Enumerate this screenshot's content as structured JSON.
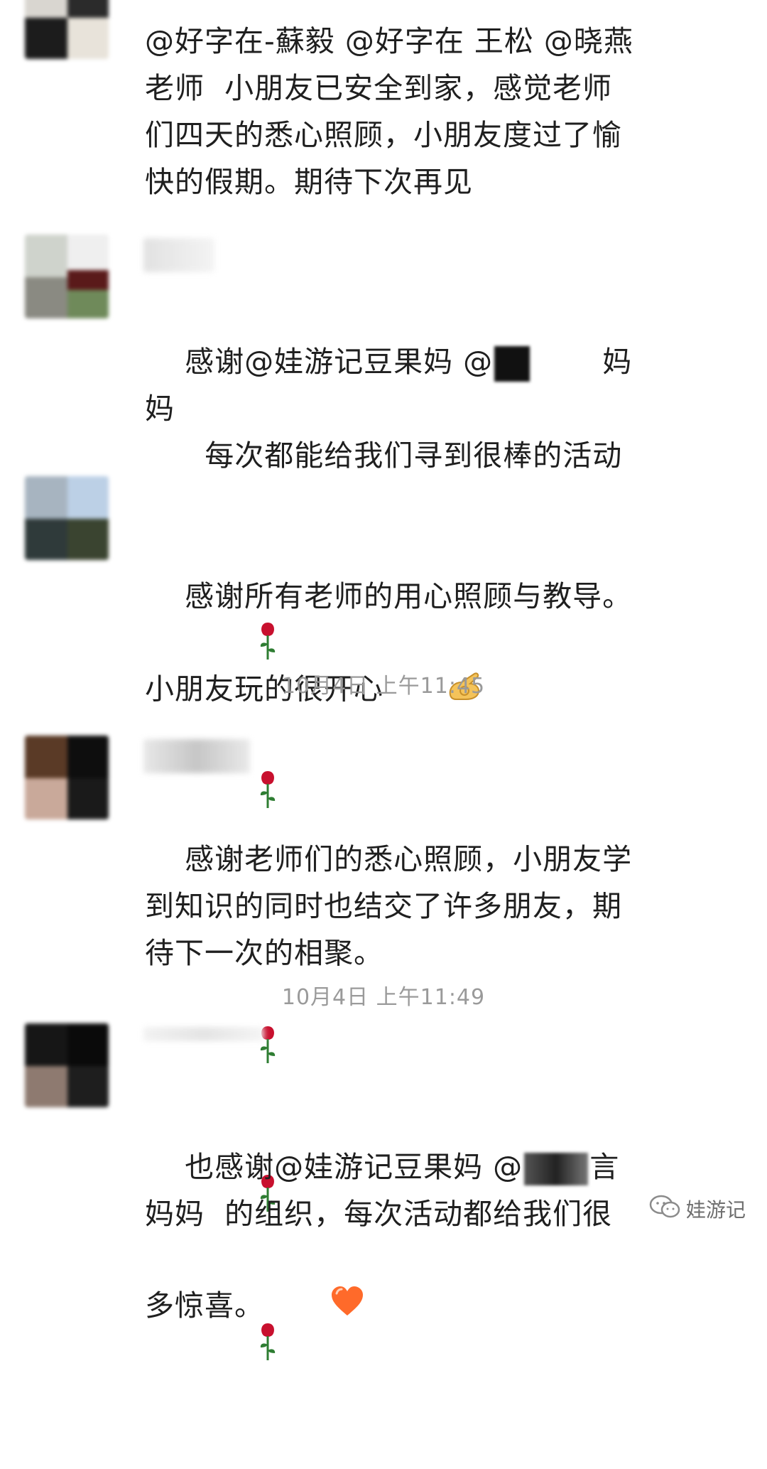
{
  "messages": [
    {
      "text": "@好字在-蘇毅 @好字在 王松 @晓燕老师  小朋友已安全到家，感觉老师们四天的悉心照顾，小朋友度过了愉快的假期。期待下次再见"
    },
    {
      "text_a": "感谢@娃游记豆果妈 @",
      "text_b": "妈妈",
      "text_c": "  每次都能给我们寻到很棒的活动",
      "emoji": "rose-icon"
    },
    {
      "text": "感谢所有老师的用心照顾与教导。小朋友玩的很开心",
      "emoji": "ok-hand-icon"
    },
    {
      "text": "感谢老师们的悉心照顾，小朋友学到知识的同时也结交了许多朋友，期待下一次的相聚。",
      "emoji": "rose-icon"
    },
    {
      "text_a": "也感谢@娃游记豆果妈 @",
      "text_b": "言妈妈",
      "text_c": "  的组织，每次活动都给我们很多惊喜。",
      "emoji": "heart-icon"
    }
  ],
  "timestamps": [
    "10月4日 上午11:45",
    "10月4日 上午11:49"
  ],
  "watermark": {
    "label": "娃游记"
  },
  "colors": {
    "text": "#1f1f1f",
    "timestamp": "#9a9a9a",
    "rose": "#c8102e",
    "heart": "#ff6a2a"
  }
}
